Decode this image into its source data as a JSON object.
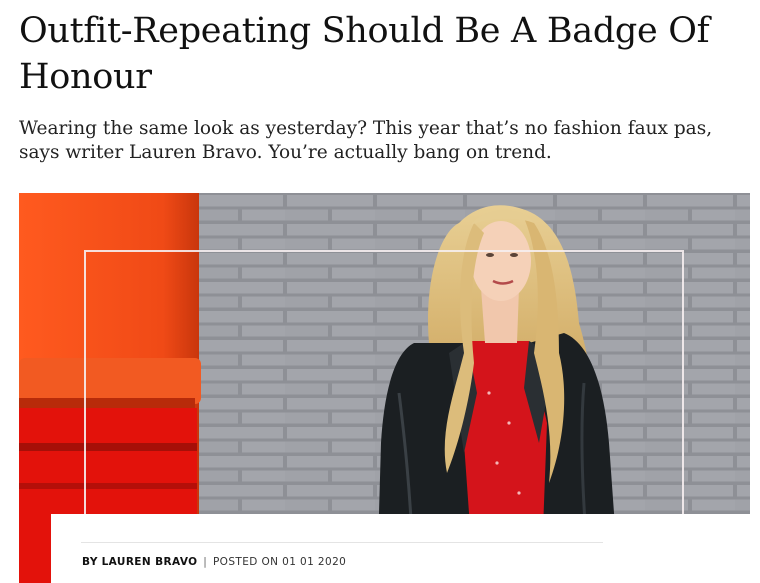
{
  "article": {
    "title": "Outfit-Repeating Should Be A Badge Of Honour",
    "standfirst": "Wearing the same look as yesterday? This year that’s no fashion faux pas, says writer Lauren Bravo. You’re actually bang on trend.",
    "byline": {
      "prefix": "BY",
      "author": "LAUREN BRAVO",
      "separator": "|",
      "posted": "POSTED ON 01 01 2020"
    },
    "hero_image": {
      "subject": "woman with long blonde hair in red dress and black leather jacket against grey brick wall next to red post box"
    }
  },
  "colors": {
    "accent_red": "#e3120b",
    "postbox_orange": "#f04a16",
    "brick_wall": "#9c9ea4",
    "jacket": "#1b1f22"
  }
}
